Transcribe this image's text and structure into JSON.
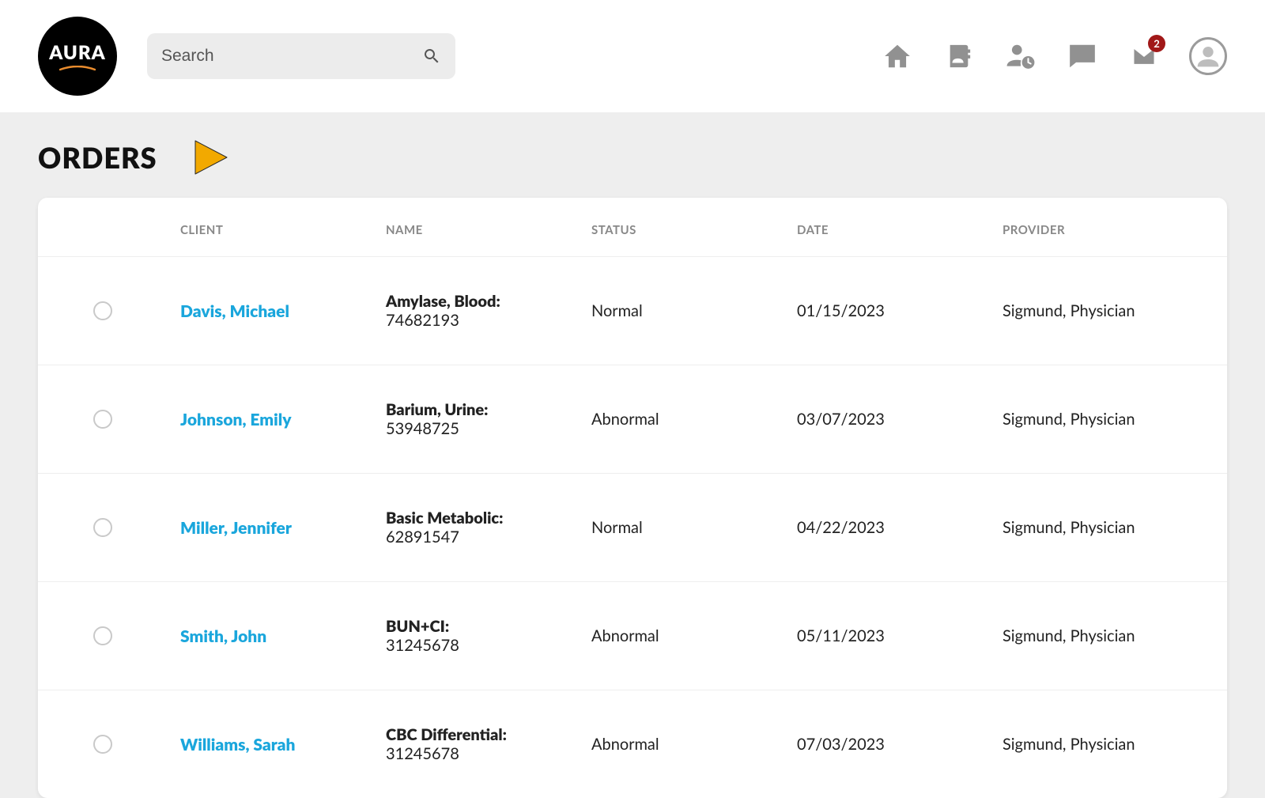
{
  "brand": "AURA",
  "search": {
    "placeholder": "Search"
  },
  "notifications": {
    "mail_badge": "2"
  },
  "page": {
    "title": "ORDERS"
  },
  "columns": {
    "client": "CLIENT",
    "name": "NAME",
    "status": "STATUS",
    "date": "DATE",
    "provider": "PROVIDER"
  },
  "orders": [
    {
      "client": "Davis, Michael",
      "test": "Amylase, Blood:",
      "id": "74682193",
      "status": "Normal",
      "date": "01/15/2023",
      "provider": "Sigmund, Physician"
    },
    {
      "client": "Johnson, Emily",
      "test": "Barium, Urine:",
      "id": "53948725",
      "status": "Abnormal",
      "date": "03/07/2023",
      "provider": "Sigmund, Physician"
    },
    {
      "client": "Miller, Jennifer",
      "test": "Basic Metabolic:",
      "id": "62891547",
      "status": "Normal",
      "date": "04/22/2023",
      "provider": "Sigmund, Physician"
    },
    {
      "client": "Smith, John",
      "test": "BUN+CI:",
      "id": "31245678",
      "status": "Abnormal",
      "date": "05/11/2023",
      "provider": "Sigmund, Physician"
    },
    {
      "client": "Williams, Sarah",
      "test": "CBC Differential:",
      "id": "31245678",
      "status": "Abnormal",
      "date": "07/03/2023",
      "provider": "Sigmund, Physician"
    }
  ]
}
